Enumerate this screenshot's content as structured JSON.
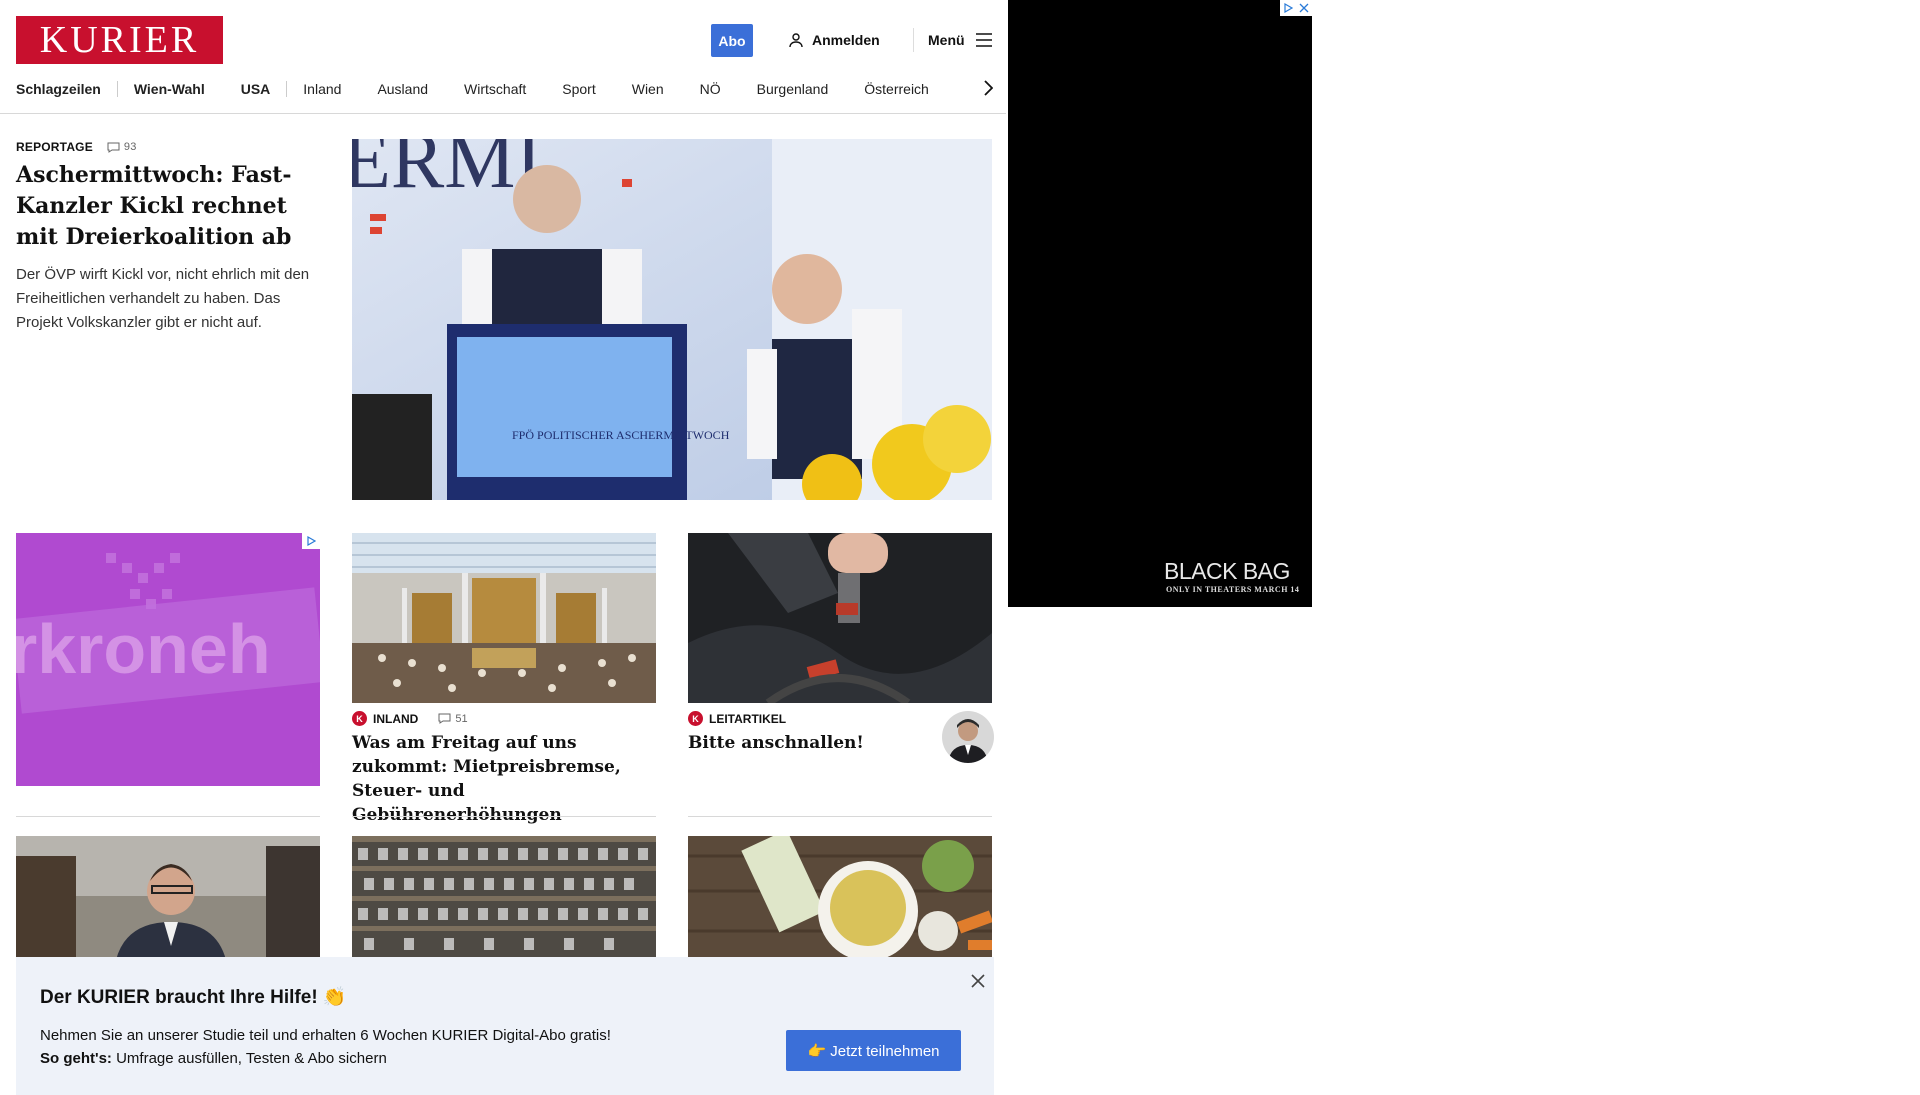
{
  "header": {
    "logo": "KURIER",
    "abo_label": "Abo",
    "login_label": "Anmelden",
    "menu_label": "Menü"
  },
  "nav": {
    "items": [
      "Schlagzeilen",
      "Wien-Wahl",
      "USA",
      "Inland",
      "Ausland",
      "Wirtschaft",
      "Sport",
      "Wien",
      "NÖ",
      "Burgenland",
      "Österreich"
    ]
  },
  "lead": {
    "kicker": "REPORTAGE",
    "comments": "93",
    "title": "Aschermittwoch: Fast-Kanzler Kickl rechnet mit Dreierkoalition ab",
    "teaser": "Der ÖVP wirft Kickl vor, nicht ehrlich mit den Freiheitlichen verhandelt zu haben. Das Projekt Volkskanzler gibt er nicht auf.",
    "image_text": "FPÖ POLITISCHER ASCHERMITTWOCH"
  },
  "ad_tile": {
    "text": "rkroneh"
  },
  "cards": [
    {
      "kicker": "INLAND",
      "comments": "51",
      "title": "Was am Freitag auf uns zukommt: Mietpreisbremse, Steuer- und Gebührenerhöhungen"
    },
    {
      "kicker": "LEITARTIKEL",
      "title": "Bitte anschnallen!"
    }
  ],
  "popup": {
    "title": "Der KURIER braucht Ihre Hilfe! 👏",
    "line1": "Nehmen Sie an unserer Studie teil und erhalten 6 Wochen KURIER Digital-Abo gratis!",
    "line2_bold": "So geht's:",
    "line2_rest": " Umfrage ausfüllen, Testen & Abo sichern",
    "button": "👉 Jetzt teilnehmen"
  },
  "side_ad": {
    "brand": "BLACK BAG",
    "tagline": "ONLY IN THEATERS MARCH 14"
  },
  "colors": {
    "brand_red": "#c8102e",
    "button_blue": "#3b6fd8",
    "ad_purple": "#b04ad0",
    "popup_bg": "#eef2f9"
  }
}
